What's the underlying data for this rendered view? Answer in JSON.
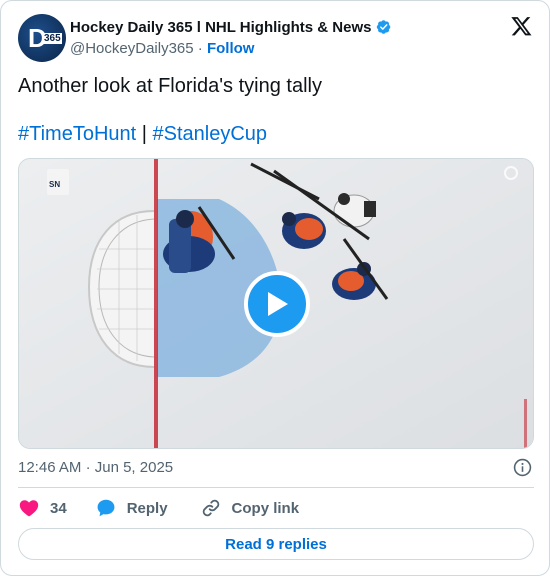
{
  "author": {
    "name": "Hockey Daily 365 l NHL Highlights & News",
    "handle": "@HockeyDaily365",
    "separator": "·",
    "follow_label": "Follow",
    "verified": true,
    "avatar_lettering": "D365"
  },
  "tweet": {
    "text": "Another look at Florida's tying tally",
    "hashtags": [
      "#TimeToHunt",
      "#StanleyCup"
    ],
    "hashtag_separator": "|"
  },
  "media": {
    "type": "video",
    "play_icon": "play-icon",
    "watermark": "SN"
  },
  "meta": {
    "time": "12:46 AM",
    "separator": "·",
    "date": "Jun 5, 2025"
  },
  "actions": {
    "like_count": "34",
    "reply_label": "Reply",
    "copy_label": "Copy link"
  },
  "read_replies_label": "Read 9 replies",
  "colors": {
    "link": "#006fd6",
    "like": "#f91880",
    "verified": "#1d9bf0",
    "reply": "#1d9bf0",
    "muted": "#536471",
    "border": "#cfd9de"
  }
}
